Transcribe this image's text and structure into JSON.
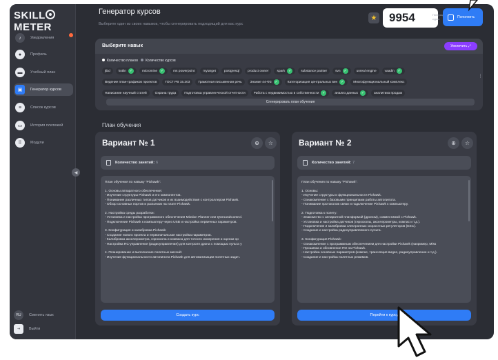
{
  "app": {
    "logo": "SKILLMETER",
    "logo_prefix": "SKILL",
    "logo_suffix": "METER"
  },
  "header": {
    "title": "Генератор курсов",
    "subtitle": "Выберите один из своих навыков, чтобы сгенерировать подходящий для вас курс",
    "points": "9954",
    "points_label": "Генерация курса",
    "refill_label": "Пополнить"
  },
  "sidebar": {
    "items": [
      {
        "label": "Уведомления",
        "icon": "bell-icon"
      },
      {
        "label": "Профиль",
        "icon": "avatar"
      },
      {
        "label": "Учебный план",
        "icon": "book-icon"
      },
      {
        "label": "Генератор курсов",
        "icon": "generator-icon",
        "active": true
      },
      {
        "label": "Список курсов",
        "icon": "list-icon"
      },
      {
        "label": "История платежей",
        "icon": "wallet-icon"
      },
      {
        "label": "Модули",
        "icon": "grid-icon"
      }
    ],
    "lang_badge": "RU",
    "lang_label": "Сменить язык",
    "logout_label": "Выйти"
  },
  "skills": {
    "title": "Выберите навык",
    "enlarge_label": "Увеличить",
    "legend_plans": "Количество планов",
    "legend_courses": "Количество курсов",
    "row1": [
      "jtbd",
      "kotlin",
      "micromine",
      "ms powerpoint",
      "mytarget",
      "postgresql",
      "product owner",
      "spark",
      "substance painter",
      "svn",
      "unreal engine",
      "vaadin"
    ],
    "row2": [
      "Ведение план-графиков проектов",
      "ГОСТ РВ 15.203",
      "Грамотная письменная речь",
      "Знание 44-ФЗ",
      "Категоризация центральных вен",
      "Многофункциональный комплекс"
    ],
    "row3": [
      "Написание научный статей",
      "Охрана труда",
      "Подготовка управленческой отчетности",
      "Работа с недвижимостью в собственности",
      "анализ данных",
      "аналитика продаж"
    ],
    "generate_label": "Сгенерировать план обучения",
    "colors": {
      "checked": "#38c172",
      "legend_plans": "#ffffff",
      "legend_courses": "#8e93a0"
    }
  },
  "plan_section_title": "План обучения",
  "variants": [
    {
      "title": "Вариант № 1",
      "lessons_label": "Количество занятий:",
      "lessons_count": "6",
      "lines": [
        "План обучения по навыку \"Pixhawk\":",
        "",
        "1. Основы аппаратного обеспечения:",
        "   - Изучение структуры Pixhawk и его компонентов.",
        "   - Понимание различных типов датчиков и их взаимодействия с контроллером Pixhawk.",
        "   - Обзор основных портов и разъемов на плате Pixhawk.",
        "",
        "2. Настройка среды разработки:",
        "   - Установка и настройка программного обеспечения Mission Planner или QGroundControl.",
        "   - Подключение Pixhawk к компьютеру через USB и настройка первичных параметров.",
        "",
        "3. Конфигурация и калибровка Pixhawk:",
        "   - Создание нового проекта и первоначальная настройка параметров.",
        "   - Калибровка акселерометра, гироскопа и компаса для точного измерения и оценки ор",
        "   - Настройка RC-управления (радиоуправления) для контроля дрона с помощью пульта у",
        "",
        "4. Планирование и выполнение полетных миссий:",
        "   - Изучение функциональности автопилота Pixhawk для автоматизации полетных задач."
      ],
      "button_label": "Создать курс"
    },
    {
      "title": "Вариант № 2",
      "lessons_label": "Количество занятий:",
      "lessons_count": "7",
      "lines": [
        "План обучения по навыку \"Pixhawk\":",
        "",
        "1. Основы:",
        "   - Изучение структуры и функциональности Pixhawk.",
        "   - Ознакомление с базовыми принципами работы автопилота.",
        "   - Понимание протоколов связи и подключение Pixhawk к компьютеру.",
        "",
        "2. Подготовка к полету:",
        "   - Знакомство с аппаратной платформой (дроном), совместимой с Pixhawk.",
        "   - Установка и настройка датчиков (гироскопы, акселерометры, компас и т.д.).",
        "   - Подключение и калибровка электронных скоростных регуляторов (ESC).",
        "   - Создание и настройка радиоуправляемого пульта.",
        "",
        "3. Конфигурация Pixhawk:",
        "   - Ознакомление с программным обеспечением для настройки Pixhawk (например, Miss",
        "   - Прошивка и обновление ПО на Pixhawk.",
        "   - Настройка основных параметров (компас, трансляция видео, радиоуправление и т.д.).",
        "   - Создание и настройка полетных режимов."
      ],
      "button_label": "Перейти к курсу"
    }
  ]
}
